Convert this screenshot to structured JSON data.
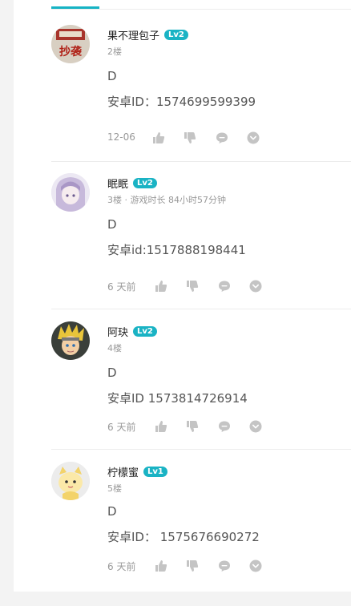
{
  "comments": [
    {
      "name": "果不理包子",
      "level": "Lv2",
      "meta": "2楼",
      "line1": "D",
      "line2": "安卓ID：1574699599399",
      "time": "12-06",
      "avatar_text": "抄袭"
    },
    {
      "name": "眠眠",
      "level": "Lv2",
      "meta": "3楼 · 游戏时长 84小时57分钟",
      "line1": "D",
      "line2": "安卓id:1517888198441",
      "time": "6 天前"
    },
    {
      "name": "阿玦",
      "level": "Lv2",
      "meta": "4楼",
      "line1": "D",
      "line2": "安卓ID  1573814726914",
      "time": "6 天前"
    },
    {
      "name": "柠檬蜜",
      "level": "Lv1",
      "meta": "5楼",
      "line1": "D",
      "line2": "安卓ID：  1575676690272",
      "time": "6 天前"
    }
  ],
  "icons": {
    "like": "thumbs-up-icon",
    "dislike": "thumbs-down-icon",
    "reply": "comment-bubble-icon",
    "more": "chevron-down-circle-icon"
  },
  "colors": {
    "accent": "#16b3c4",
    "level_badge": "#1ab3c4",
    "muted": "#999999",
    "icon": "#c4c4c4"
  }
}
